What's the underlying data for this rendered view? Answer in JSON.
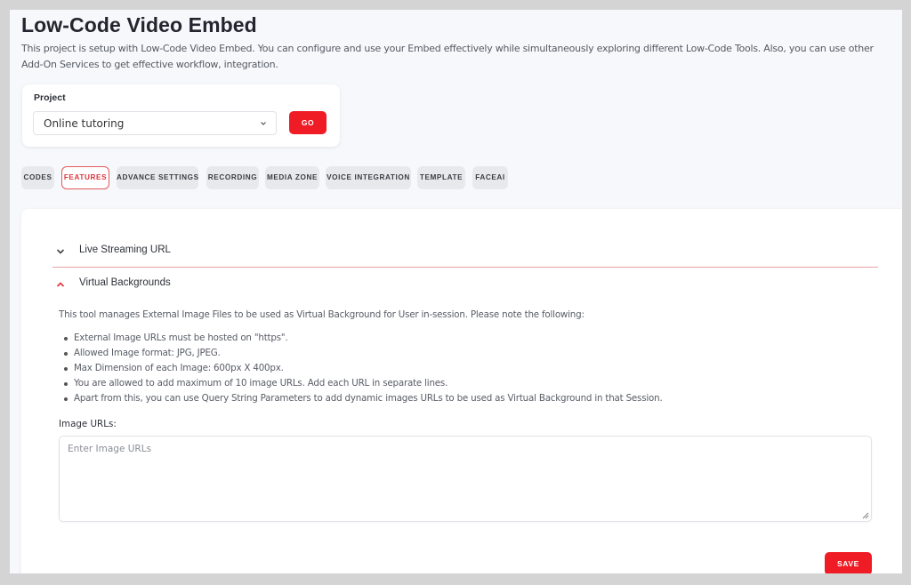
{
  "header": {
    "title": "Low-Code Video Embed",
    "intro": "This project is setup with Low-Code Video Embed. You can configure and use your Embed effectively while simultaneously exploring different Low-Code Tools. Also, you can use other Add-On Services to get effective workflow, integration."
  },
  "project": {
    "label": "Project",
    "selected": "Online tutoring",
    "go_label": "GO"
  },
  "tabs": [
    {
      "label": "CODES",
      "active": false
    },
    {
      "label": "FEATURES",
      "active": true
    },
    {
      "label": "ADVANCE SETTINGS",
      "active": false
    },
    {
      "label": "RECORDING",
      "active": false
    },
    {
      "label": "MEDIA ZONE",
      "active": false
    },
    {
      "label": "VOICE INTEGRATION",
      "active": false
    },
    {
      "label": "TEMPLATE",
      "active": false
    },
    {
      "label": "FACEAI",
      "active": false
    }
  ],
  "accordion": {
    "live_streaming": {
      "label": "Live Streaming URL",
      "expanded": false
    },
    "virtual_backgrounds": {
      "label": "Virtual Backgrounds",
      "expanded": true,
      "description": "This tool manages External Image Files to be used as Virtual Background for User in-session. Please note the following:",
      "notes": [
        "External Image URLs must be hosted on \"https\".",
        "Allowed Image format: JPG, JPEG.",
        "Max Dimension of each Image: 600px X 400px.",
        "You are allowed to add maximum of 10 image URLs. Add each URL in separate lines.",
        "Apart from this, you can use Query String Parameters to add dynamic images URLs to be used as Virtual Background in that Session."
      ],
      "image_urls_label": "Image URLs:",
      "image_urls_placeholder": "Enter Image URLs",
      "image_urls_value": "",
      "save_label": "SAVE"
    }
  },
  "colors": {
    "accent": "#ef1c25",
    "active_tab_border": "#e05a5a",
    "page_bg": "#f7f8fb"
  },
  "icons": {
    "select_chevron": "chevron-down-icon",
    "collapsed_chevron": "chevron-down-icon",
    "expanded_chevron": "chevron-up-icon"
  }
}
